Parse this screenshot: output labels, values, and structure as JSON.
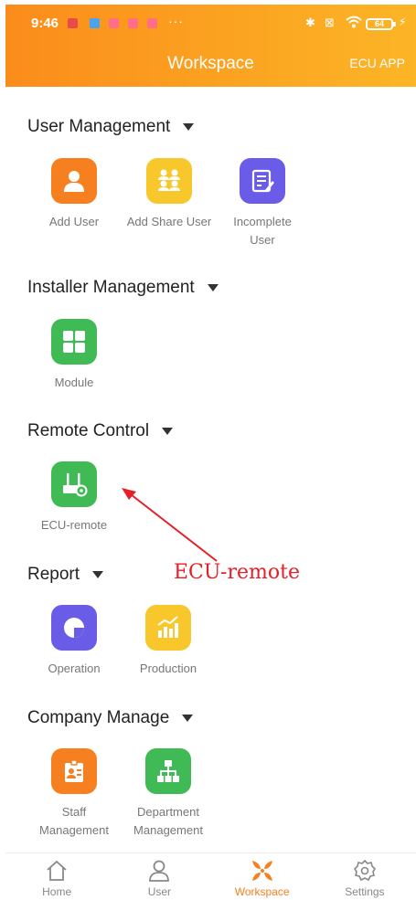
{
  "status_bar": {
    "time": "9:46",
    "overflow": "···",
    "battery": "64"
  },
  "header": {
    "title": "Workspace",
    "right_link": "ECU APP"
  },
  "sections": {
    "user_management": {
      "title": "User Management",
      "items": [
        "Add User",
        "Add Share User",
        "Incomplete User"
      ]
    },
    "installer_management": {
      "title": "Installer Management",
      "items": [
        "Module"
      ]
    },
    "remote_control": {
      "title": "Remote Control",
      "items": [
        "ECU-remote"
      ]
    },
    "report": {
      "title": "Report",
      "items": [
        "Operation",
        "Production"
      ]
    },
    "company_manage": {
      "title": "Company Manage",
      "items": [
        "Staff Management",
        "Department Management"
      ]
    }
  },
  "annotation": {
    "text": "ECU-remote",
    "color": "#e81e26"
  },
  "tabs": [
    {
      "label": "Home",
      "icon": "home-icon"
    },
    {
      "label": "User",
      "icon": "user-icon"
    },
    {
      "label": "Workspace",
      "icon": "workspace-icon",
      "active": true
    },
    {
      "label": "Settings",
      "icon": "settings-icon"
    }
  ],
  "colors": {
    "accent": "#f6801f",
    "yellow": "#f8c72b",
    "purple": "#6b5ce7",
    "green": "#3fba54"
  }
}
